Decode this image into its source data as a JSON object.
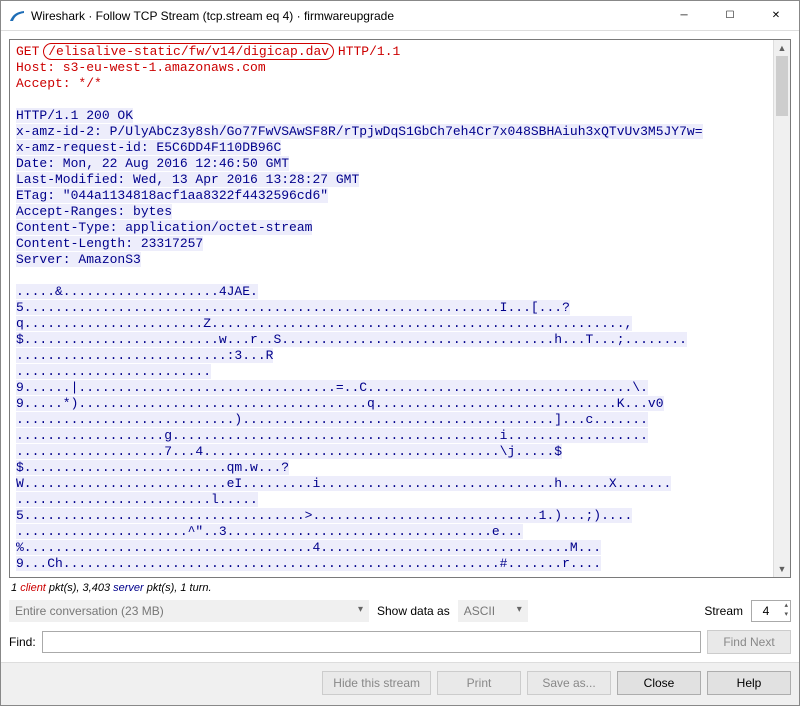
{
  "window": {
    "title": "Wireshark · Follow TCP Stream (tcp.stream eq 4) · firmwareupgrade"
  },
  "request": {
    "method": "GET",
    "path": "/elisalive-static/fw/v14/digicap.dav",
    "version": "HTTP/1.1",
    "host_header": "Host: s3-eu-west-1.amazonaws.com",
    "accept_header": "Accept: */*"
  },
  "response": {
    "status": "HTTP/1.1 200 OK",
    "amz_id2": "x-amz-id-2: P/UlyAbCz3y8sh/Go77FwVSAwSF8R/rTpjwDqS1GbCh7eh4Cr7x048SBHAiuh3xQTvUv3M5JY7w=",
    "amz_request_id": "x-amz-request-id: E5C6DD4F110DB96C",
    "date": "Date: Mon, 22 Aug 2016 12:46:50 GMT",
    "last_modified": "Last-Modified: Wed, 13 Apr 2016 13:28:27 GMT",
    "etag": "ETag: \"044a1134818acf1aa8322f4432596cd6\"",
    "accept_ranges": "Accept-Ranges: bytes",
    "content_type": "Content-Type: application/octet-stream",
    "content_length": "Content-Length: 23317257",
    "server": "Server: AmazonS3"
  },
  "binary_lines": [
    ".....&....................4JAE.",
    "5.............................................................I...[...?",
    "q.......................Z.....................................................,",
    "$.........................w...r..S...................................h...T...;........",
    "...........................:3...R",
    ".........................",
    "9......|.................................=..C..................................\\.",
    "9.....*).....................................q...............................K...v0",
    "............................)........................................]...c.......",
    "...................g..........................................i..................",
    "...................7...4......................................\\j.....$",
    "$..........................qm.w...?",
    "W..........................eI.........i..............................h......X.......",
    ".........................l.....",
    "5....................................>.............................1.)...;)....",
    "......................^\"..3..................................e...",
    "%.....................................4................................M...",
    "9...Ch........................................................#.......r...."
  ],
  "status": {
    "client_pkts": "1",
    "client_label": "client",
    "mid1": " pkt(s), ",
    "server_pkts": "3,403",
    "server_label": "server",
    "mid2": " pkt(s), ",
    "turns": "1 turn."
  },
  "controls": {
    "conversation": "Entire conversation (23 MB)",
    "show_label": "Show data as",
    "show_value": "ASCII",
    "stream_label": "Stream",
    "stream_value": "4"
  },
  "find": {
    "label": "Find:",
    "placeholder": "",
    "button": "Find Next"
  },
  "buttons": {
    "hide": "Hide this stream",
    "print": "Print",
    "save": "Save as...",
    "close": "Close",
    "help": "Help"
  }
}
